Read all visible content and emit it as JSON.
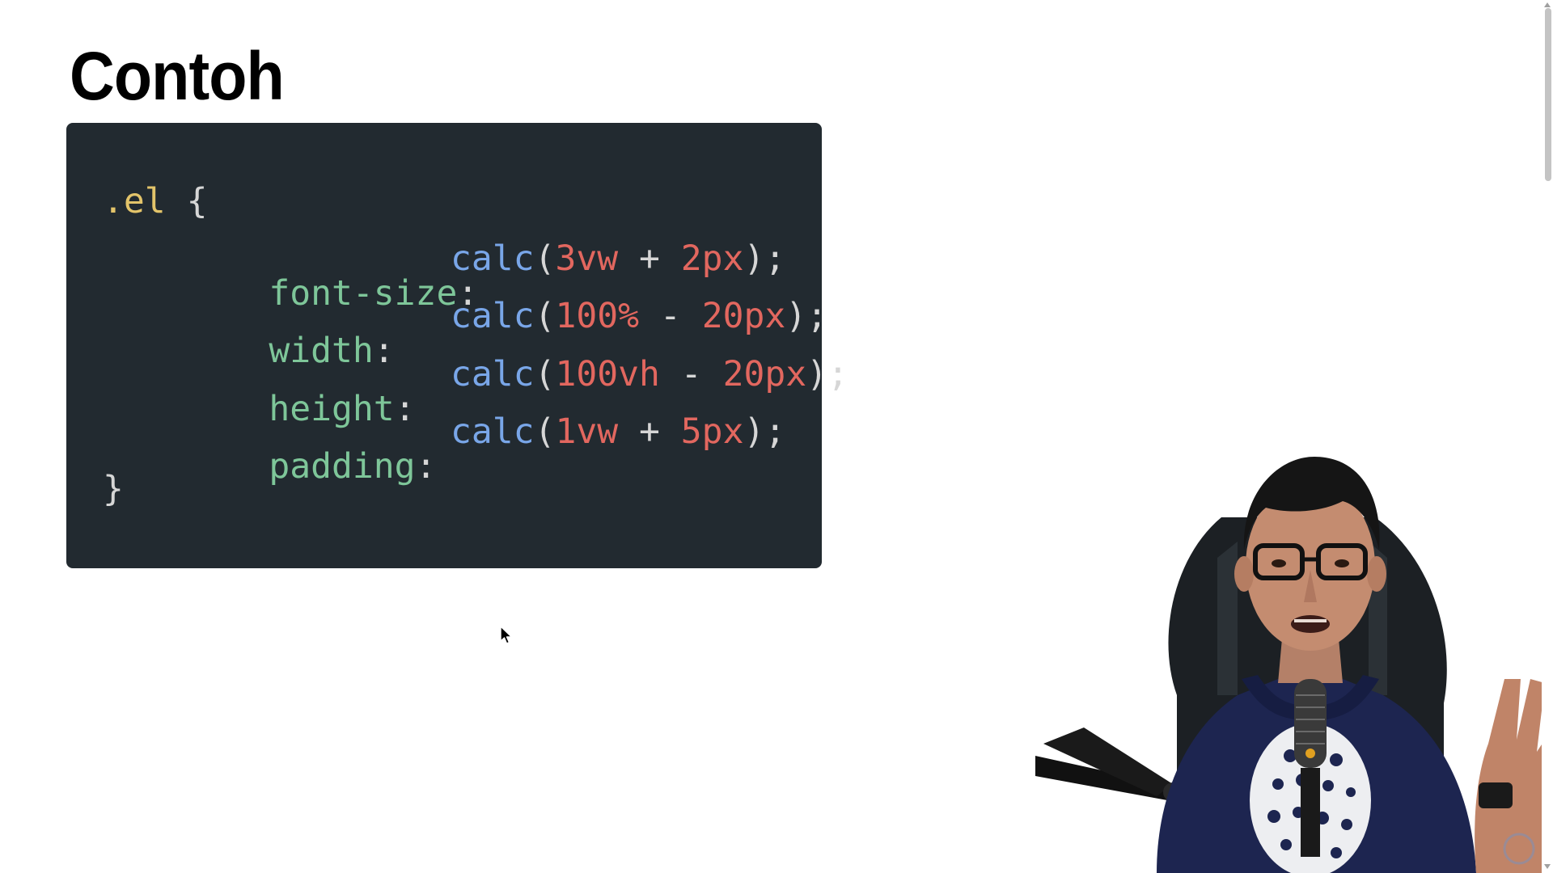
{
  "slide": {
    "title": "Contoh"
  },
  "code": {
    "selector": ".el",
    "open_brace": "{",
    "close_brace": "}",
    "lines": [
      {
        "prop": "font-size",
        "colon": ":",
        "fn": "calc",
        "paren_open": "(",
        "arg1": "3vw",
        "op": " + ",
        "arg2": "2px",
        "paren_close": ");"
      },
      {
        "prop": "width",
        "colon": ":",
        "fn": "calc",
        "paren_open": "(",
        "arg1": "100%",
        "op": " - ",
        "arg2": "20px",
        "paren_close": ");"
      },
      {
        "prop": "height",
        "colon": ":",
        "fn": "calc",
        "paren_open": "(",
        "arg1": "100vh",
        "op": " - ",
        "arg2": "20px",
        "paren_close": ");"
      },
      {
        "prop": "padding",
        "colon": ":",
        "fn": "calc",
        "paren_open": "(",
        "arg1": "1vw",
        "op": " + ",
        "arg2": "5px",
        "paren_close": ");"
      }
    ]
  },
  "colors": {
    "code_background": "#222a30",
    "selector": "#e3c46a",
    "property": "#7ec699",
    "function": "#79a6e8",
    "number": "#e2675f",
    "punctuation": "#d6d6d6"
  },
  "icons": {
    "cursor": "mouse-pointer-icon",
    "presenter": "presenter-webcam-icon"
  }
}
